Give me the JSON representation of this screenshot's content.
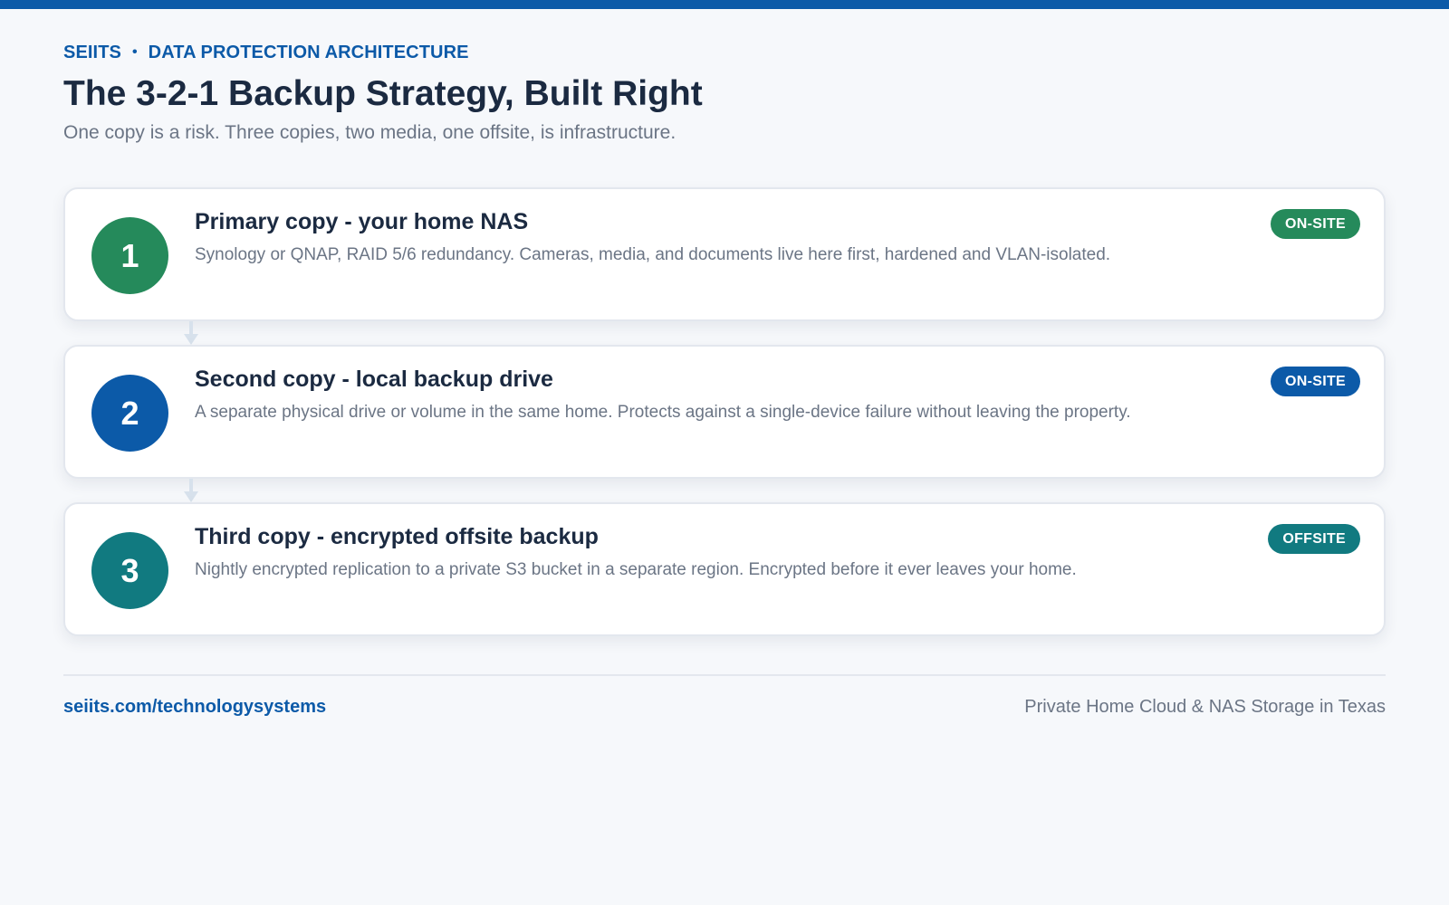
{
  "header": {
    "brand": "SEIITS",
    "separator": "•",
    "section": "DATA PROTECTION ARCHITECTURE",
    "title": "The 3-2-1 Backup Strategy, Built Right",
    "subtitle": "One copy is a risk. Three copies, two media, one offsite, is infrastructure."
  },
  "colors": {
    "accent": "#0c5aa8",
    "green": "#258a5b",
    "blue": "#0c5aa8",
    "teal": "#117a80",
    "connector": "#d7e1ec"
  },
  "steps": [
    {
      "number": "1",
      "title": "Primary copy - your home NAS",
      "description": "Synology or QNAP, RAID 5/6 redundancy. Cameras, media, and documents live here first, hardened and VLAN-isolated.",
      "badge": "ON-SITE",
      "color": "#258a5b"
    },
    {
      "number": "2",
      "title": "Second copy - local backup drive",
      "description": "A separate physical drive or volume in the same home. Protects against a single-device failure without leaving the property.",
      "badge": "ON-SITE",
      "color": "#0c5aa8"
    },
    {
      "number": "3",
      "title": "Third copy - encrypted offsite backup",
      "description": "Nightly encrypted replication to a private S3 bucket in a separate region. Encrypted before it ever leaves your home.",
      "badge": "OFFSITE",
      "color": "#117a80"
    }
  ],
  "footer": {
    "link": "seiits.com/technologysystems",
    "tagline": "Private Home Cloud & NAS Storage in Texas"
  }
}
